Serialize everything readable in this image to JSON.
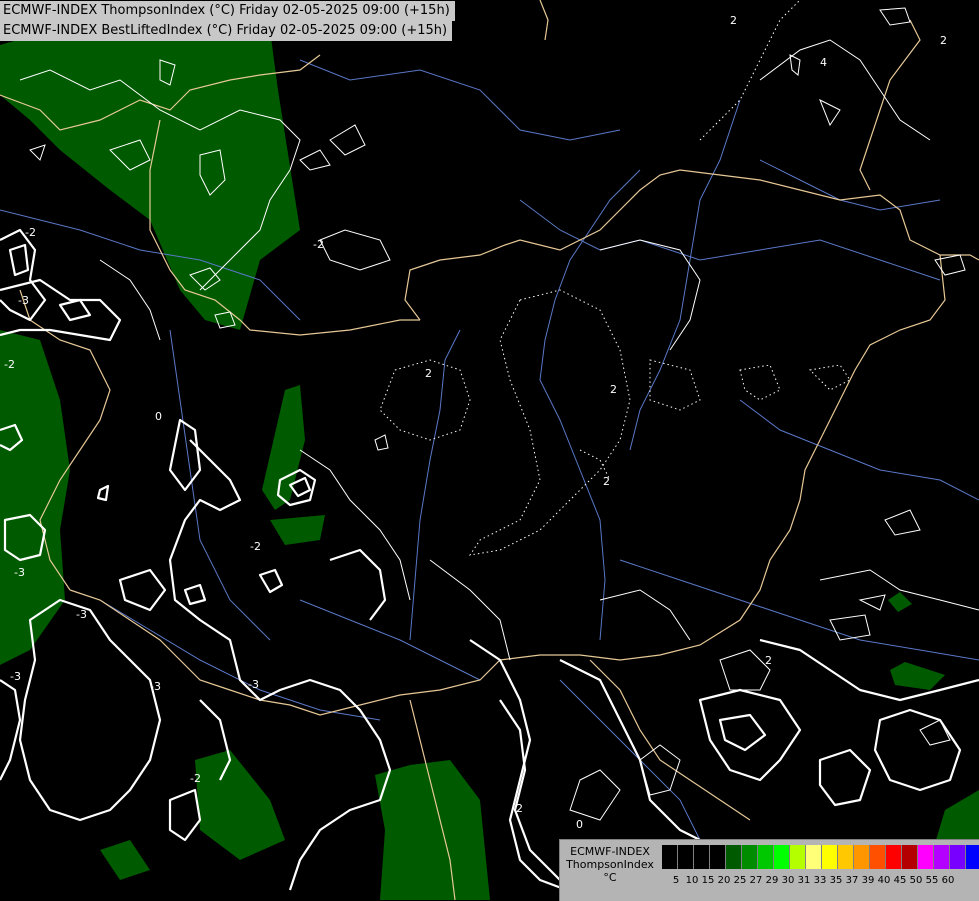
{
  "titles": {
    "line1": "ECMWF-INDEX ThompsonIndex (°C) Friday 02-05-2025 09:00 (+15h)",
    "line2": "ECMWF-INDEX BestLiftedIndex (°C) Friday 02-05-2025 09:00 (+15h)"
  },
  "legend": {
    "line1": "ECMWF-INDEX",
    "line2": "ThompsonIndex",
    "line3": "°C",
    "ticks": [
      "5",
      "10",
      "15",
      "20",
      "25",
      "27",
      "29",
      "30",
      "31",
      "33",
      "35",
      "37",
      "39",
      "40",
      "45",
      "50",
      "55",
      "60"
    ],
    "colors": [
      "#000000",
      "#000000",
      "#000000",
      "#000000",
      "#005a00",
      "#008c00",
      "#00c800",
      "#00ff00",
      "#b4ff00",
      "#ffff78",
      "#ffff00",
      "#ffc800",
      "#ff9600",
      "#ff5000",
      "#ff0000",
      "#b40000",
      "#ff00ff",
      "#b400ff",
      "#7800ff",
      "#0000ff"
    ]
  },
  "contour_labels": [
    "2",
    "4",
    "2",
    "-2",
    "-3",
    "-2",
    "-3",
    "0",
    "-2",
    "2",
    "2",
    "2",
    "-2",
    "-3",
    "-3",
    "-3",
    "-3",
    "-2",
    "-2",
    "0",
    "2"
  ],
  "colors": {
    "background": "#000000",
    "green_fill": "#005a00",
    "border": "#e6c896",
    "river": "#5a78c8",
    "contour": "#ffffff"
  }
}
